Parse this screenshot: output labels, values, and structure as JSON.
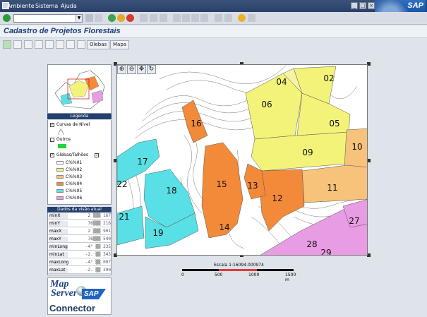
{
  "menu": {
    "items": [
      "Ambiente",
      "Sistema",
      "Ajuda"
    ]
  },
  "brand": {
    "sap_logo": "SAP"
  },
  "page": {
    "title": "Cadastro de Projetos Florestais"
  },
  "app_toolbar": {
    "olebas_label": "Olebas",
    "mapa_label": "Mapa"
  },
  "legend": {
    "title": "Legenda",
    "curvas_label": "Curvas de Nível",
    "outros_label": "Outros",
    "glebas_label": "Glebas/Talhões",
    "classes": [
      {
        "label": "C%%01",
        "color": "#ffffff"
      },
      {
        "label": "C%%02",
        "color": "#f3f37a"
      },
      {
        "label": "C%%03",
        "color": "#f7c27a"
      },
      {
        "label": "C%%04",
        "color": "#f28a3a"
      },
      {
        "label": "C%%05",
        "color": "#58e0e6"
      },
      {
        "label": "C%%06",
        "color": "#e79ce3"
      }
    ]
  },
  "view_data": {
    "title": "Dados da visão atual",
    "rows": [
      {
        "key": "minX",
        "value": "2 ▒▒▒ 167"
      },
      {
        "key": "minY",
        "value": "76▒▒▒ 216"
      },
      {
        "key": "maxX",
        "value": "2 ▒▒▒ 901"
      },
      {
        "key": "maxY",
        "value": "76▒▒▒ 540"
      },
      {
        "key": "minLong",
        "value": "-4° ▒▒ 235"
      },
      {
        "key": "minLat",
        "value": "-2. ▒▒ 345"
      },
      {
        "key": "maxLong",
        "value": "-4° ▒▒ 007"
      },
      {
        "key": "maxLat",
        "value": "-2. ▒▒ 290"
      }
    ]
  },
  "logo": {
    "map": "Map",
    "server": "Server",
    "sap": "SAP",
    "connector": "Connector"
  },
  "map": {
    "plots": [
      "02",
      "04",
      "05",
      "06",
      "09",
      "10",
      "11",
      "12",
      "13",
      "14",
      "15",
      "16",
      "17",
      "18",
      "19",
      "21",
      "22",
      "27",
      "28",
      "29"
    ]
  },
  "scale": {
    "label": "Escala  1:16094.000974",
    "ticks": [
      "0",
      "500",
      "1000",
      "1500 m"
    ]
  },
  "colors": {
    "accent": "#1e3f7a",
    "panel_header": "#24406f"
  }
}
